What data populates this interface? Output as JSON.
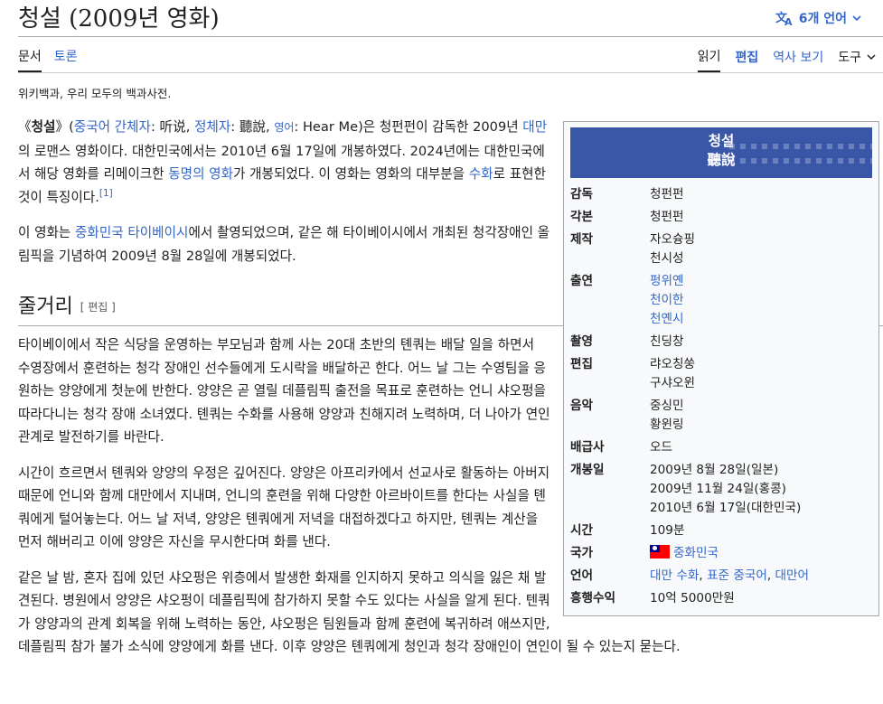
{
  "page": {
    "title": "청설 (2009년 영화)",
    "languages_label": "6개 언어",
    "tagline": "위키백과, 우리 모두의 백과사전."
  },
  "tabs": {
    "article": "문서",
    "talk": "토론",
    "read": "읽기",
    "edit": "편집",
    "history": "역사 보기",
    "tools": "도구"
  },
  "intro": {
    "p1": {
      "open": "《",
      "title_bold": "청설",
      "close": "》(",
      "zh_simplified_link": "중국어 간체자",
      "zh_simplified": ": 听说, ",
      "zh_traditional_link": "정체자",
      "zh_traditional": ": 聽說, ",
      "english_link": "영어",
      "english": ": Hear Me)은 청펀펀이 감독한 2009년 ",
      "taiwan_link": "대만",
      "rest1": "의 로맨스 영화이다. 대한민국에서는 2010년 6월 17일에 개봉하였다. 2024년에는 대한민국에서 해당 영화를 리메이크한 ",
      "remake_link": "동명의 영화",
      "rest2": "가 개봉되었다. 이 영화는 영화의 대부분을 ",
      "sign_link": "수화",
      "rest3": "로 표현한 것이 특징이다.",
      "ref": "[1]"
    },
    "p2": {
      "a": "이 영화는 ",
      "taipei_link": "중화민국 타이베이시",
      "b": "에서 촬영되었으며, 같은 해 타이베이시에서 개최된 청각장애인 올림픽을 기념하여 2009년 8월 28일에 개봉되었다."
    }
  },
  "plot": {
    "heading": "줄거리",
    "edit_label": "[ 편집 ]",
    "paragraphs": [
      "타이베이에서 작은 식당을 운영하는 부모님과 함께 사는 20대 초반의 톈쿼는 배달 일을 하면서 수영장에서 훈련하는 청각 장애인 선수들에게 도시락을 배달하곤 한다. 어느 날 그는 수영팀을 응원하는 양양에게 첫눈에 반한다. 양양은 곧 열릴 데플림픽 출전을 목표로 훈련하는 언니 샤오펑을 따라다니는 청각 장애 소녀였다. 톈쿼는 수화를 사용해 양양과 친해지려 노력하며, 더 나아가 연인 관계로 발전하기를 바란다.",
      "시간이 흐르면서 톈쿼와 양양의 우정은 깊어진다. 양양은 아프리카에서 선교사로 활동하는 아버지 때문에 언니와 함께 대만에서 지내며, 언니의 훈련을 위해 다양한 아르바이트를 한다는 사실을 톈쿼에게 털어놓는다. 어느 날 저녁, 양양은 톈쿼에게 저녁을 대접하겠다고 하지만, 톈쿼는 계산을 먼저 해버리고 이에 양양은 자신을 무시한다며 화를 낸다.",
      "같은 날 밤, 혼자 집에 있던 샤오펑은 위층에서 발생한 화재를 인지하지 못하고 의식을 잃은 채 발견된다. 병원에서 양양은 샤오펑이 데플림픽에 참가하지 못할 수도 있다는 사실을 알게 된다. 텐쿼가 양양과의 관계 회복을 위해 노력하는 동안, 샤오펑은 팀원들과 함께 훈련에 복귀하려 애쓰지만, 데플림픽 참가 불가 소식에 양양에게 화를 낸다. 이후 양양은 톈쿼에게 청인과 청각 장애인이 연인이 될 수 있는지 묻는다."
    ]
  },
  "infobox": {
    "title_ko": "청설",
    "title_zh": "聽說",
    "rows": {
      "director": {
        "label": "감독",
        "value": "청펀펀"
      },
      "writer": {
        "label": "각본",
        "value": "청펀펀"
      },
      "producer": {
        "label": "제작",
        "values": [
          "자오슝핑",
          "천시성"
        ]
      },
      "starring": {
        "label": "출연",
        "values": [
          "펑위옌",
          "천이한",
          "천옌시"
        ]
      },
      "cinematography": {
        "label": "촬영",
        "value": "친딩창"
      },
      "editing": {
        "label": "편집",
        "values": [
          "랴오칭쑹",
          "구샤오윈"
        ]
      },
      "music": {
        "label": "음악",
        "values": [
          "중싱민",
          "황윈링"
        ]
      },
      "distributor": {
        "label": "배급사",
        "value": "오드"
      },
      "release": {
        "label": "개봉일",
        "values": [
          "2009년 8월 28일(일본)",
          "2009년 11월 24일(홍콩)",
          "2010년 6월 17일(대한민국)"
        ]
      },
      "runtime": {
        "label": "시간",
        "value": "109분"
      },
      "country": {
        "label": "국가",
        "value": "중화민국"
      },
      "language": {
        "label": "언어",
        "values": [
          "대만 수화",
          "표준 중국어",
          "대만어"
        ],
        "sep": ", "
      },
      "gross": {
        "label": "흥행수익",
        "value": "10억 5000만원"
      }
    }
  },
  "colors": {
    "link": "#3366cc",
    "infobox_header": "#3a56a6",
    "text": "#202122"
  }
}
